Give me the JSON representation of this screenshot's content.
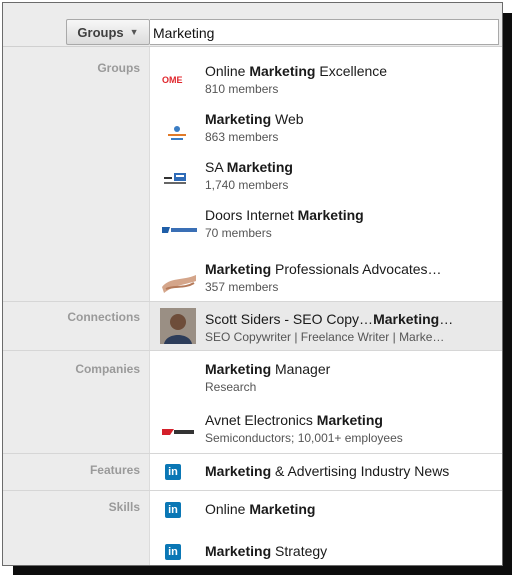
{
  "search": {
    "scope_label": "Groups",
    "query": "Marketing"
  },
  "sections": {
    "groups": "Groups",
    "connections": "Connections",
    "companies": "Companies",
    "features": "Features",
    "skills": "Skills"
  },
  "groups": [
    {
      "pre": "Online ",
      "bold": "Marketing",
      "post": " Excellence",
      "sub": "810 members",
      "logo": "OME"
    },
    {
      "pre": "",
      "bold": "Marketing",
      "post": " Web",
      "sub": "863 members",
      "logo": ""
    },
    {
      "pre": "SA ",
      "bold": "Marketing",
      "post": "",
      "sub": "1,740 members",
      "logo": ""
    },
    {
      "pre": "Doors Internet ",
      "bold": "Marketing",
      "post": "",
      "sub": "70 members",
      "logo": ""
    },
    {
      "pre": "",
      "bold": "Marketing",
      "post": " Professionals Advocates…",
      "sub": "357 members",
      "logo": ""
    }
  ],
  "connections": [
    {
      "pre": "Scott Siders - SEO Copy…",
      "bold": "Marketing",
      "post": "…",
      "sub": "SEO Copywriter | Freelance Writer | Marke…"
    }
  ],
  "companies": [
    {
      "pre": "",
      "bold": "Marketing",
      "post": " Manager",
      "sub": "Research"
    },
    {
      "pre": "Avnet Electronics ",
      "bold": "Marketing",
      "post": "",
      "sub": "Semiconductors; 10,001+ employees"
    }
  ],
  "features": [
    {
      "pre": "",
      "bold": "Marketing",
      "post": " & Advertising Industry News",
      "icon": "in"
    }
  ],
  "skills": [
    {
      "pre": "Online ",
      "bold": "Marketing",
      "post": "",
      "icon": "in"
    },
    {
      "pre": "",
      "bold": "Marketing",
      "post": " Strategy",
      "icon": "in"
    }
  ],
  "colors": {
    "linkedin_blue": "#0a77b5",
    "highlight_row": "#e9e9e9",
    "label_gray": "#9a9a9a"
  }
}
